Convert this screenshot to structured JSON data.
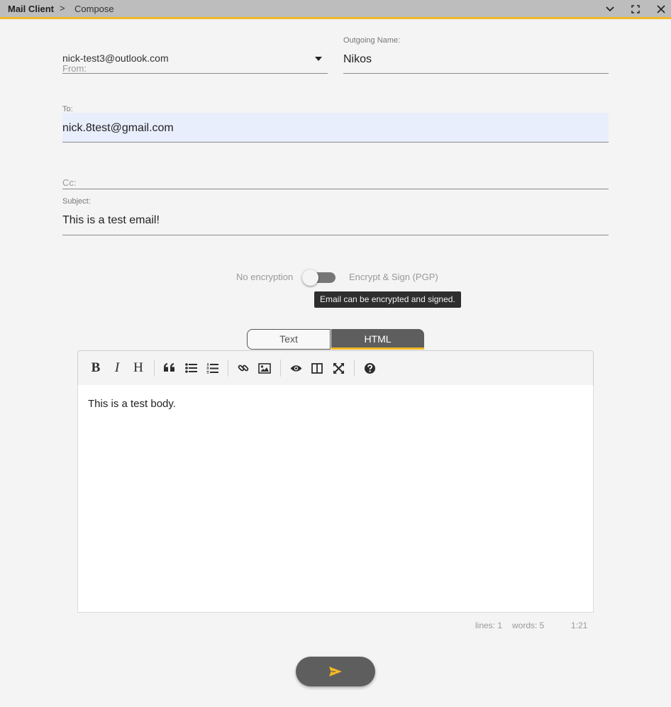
{
  "titlebar": {
    "app_name": "Mail Client",
    "separator": ">",
    "page": "Compose",
    "icons": [
      "chevron-down-icon",
      "maximize-icon",
      "close-icon"
    ]
  },
  "compose": {
    "from": {
      "value": "nick-test3@outlook.com",
      "label": "From:"
    },
    "outgoing_name": {
      "label": "Outgoing Name:",
      "value": "Nikos"
    },
    "to": {
      "label": "To:",
      "value": "nick.8test@gmail.com"
    },
    "cc": {
      "label": "Cc:",
      "value": ""
    },
    "subject": {
      "label": "Subject:",
      "value": "This is a test email!"
    }
  },
  "encryption": {
    "left_label": "No encryption",
    "right_label": "Encrypt & Sign (PGP)",
    "enabled": false,
    "tooltip": "Email can be encrypted and signed."
  },
  "format_tabs": [
    {
      "label": "Text",
      "active": false
    },
    {
      "label": "HTML",
      "active": true
    }
  ],
  "toolbar": {
    "buttons": [
      "bold-icon",
      "italic-icon",
      "heading-icon",
      "quote-icon",
      "bullet-list-icon",
      "numbered-list-icon",
      "link-icon",
      "image-icon",
      "preview-icon",
      "side-by-side-icon",
      "fullscreen-icon",
      "help-icon"
    ],
    "bold_glyph": "B",
    "italic_glyph": "I",
    "heading_glyph": "H"
  },
  "editor": {
    "body": "This is a test body."
  },
  "statusbar": {
    "lines": "lines: 1",
    "words": "words: 5",
    "cursor": "1:21"
  },
  "send": {
    "icon": "send-icon"
  },
  "colors": {
    "accent": "#f2b824",
    "dark": "#5e5e5e",
    "titlebar": "#bdbdbd",
    "to_highlight": "#e8eefb"
  }
}
